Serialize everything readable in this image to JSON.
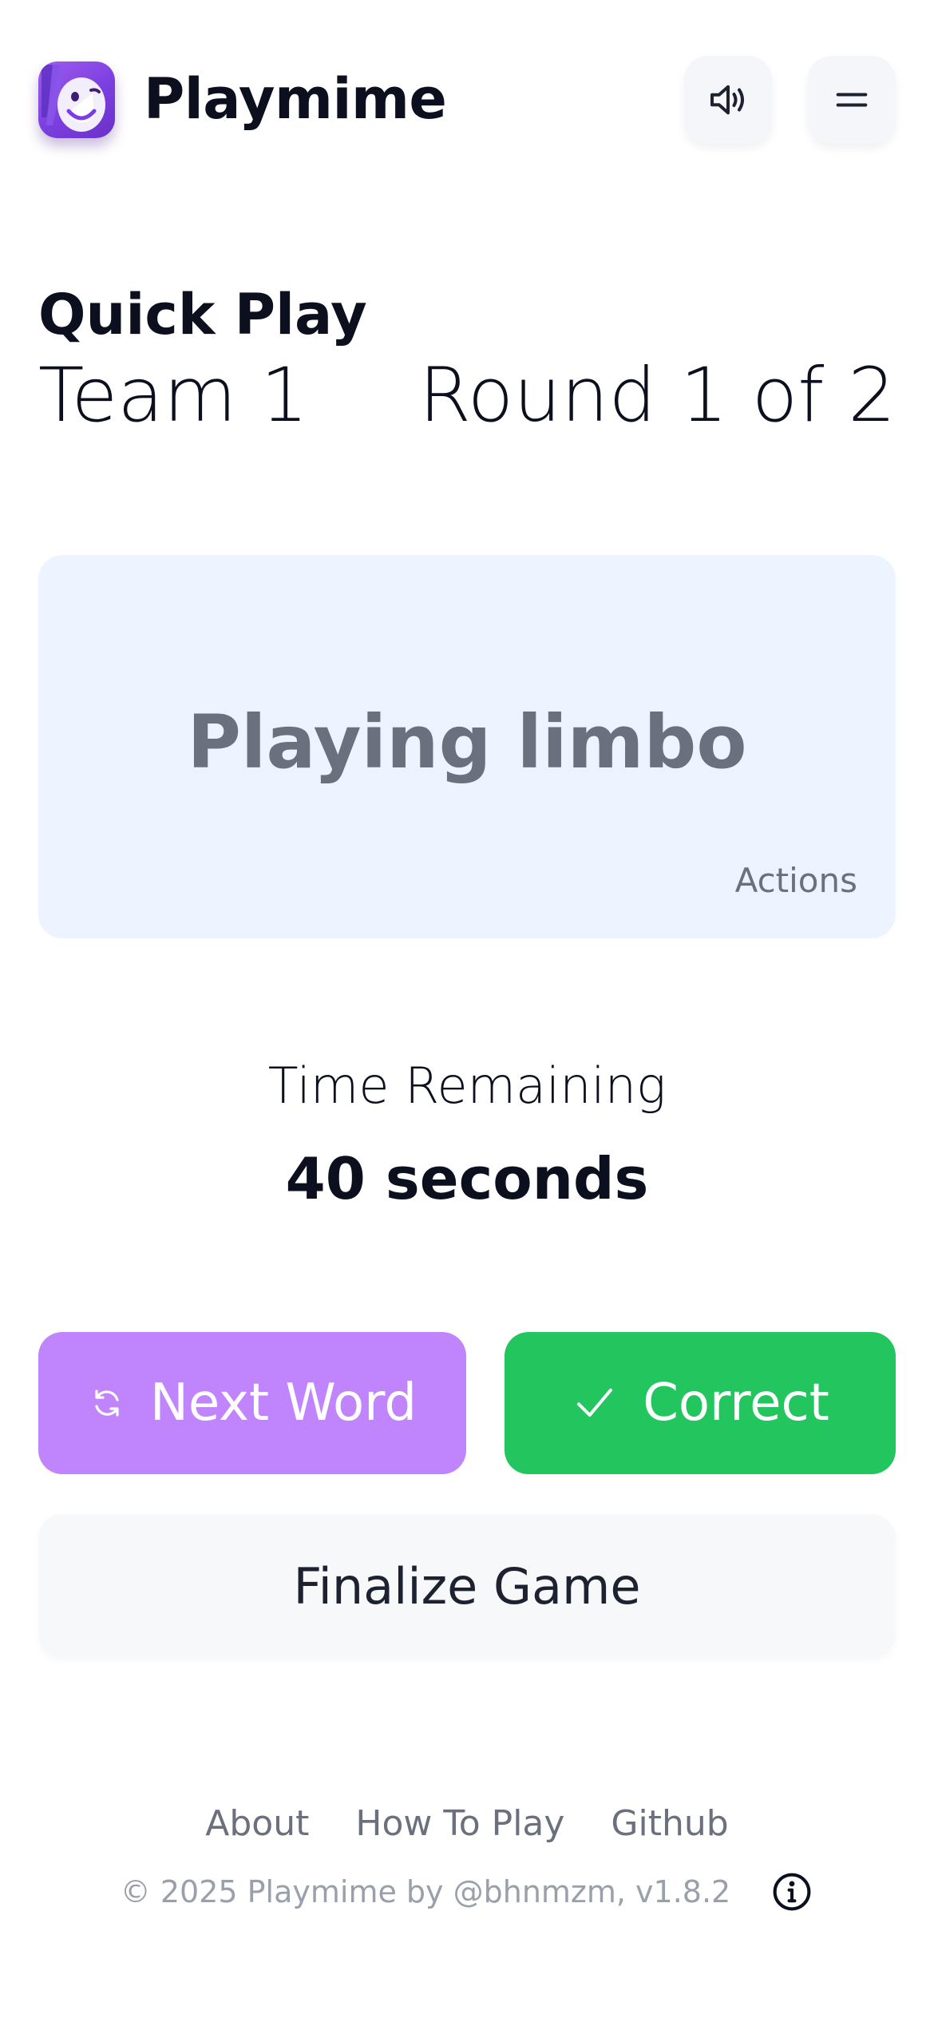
{
  "header": {
    "app_name": "Playmime",
    "logo_icon": "smiling-mime-face",
    "sound_icon": "speaker-icon",
    "menu_icon": "hamburger-menu-icon"
  },
  "game": {
    "mode": "Quick Play",
    "team": "Team 1",
    "round": "Round 1 of 2"
  },
  "card": {
    "word": "Playing limbo",
    "category": "Actions"
  },
  "timer": {
    "label": "Time Remaining",
    "value": "40 seconds"
  },
  "actions": {
    "next_word": "Next Word",
    "correct": "Correct",
    "finalize": "Finalize Game"
  },
  "footer": {
    "links": [
      "About",
      "How To Play",
      "Github"
    ],
    "copyright": "© 2025 Playmime by @bhnmzm, v1.8.2"
  },
  "colors": {
    "next_word_bg": "#c084fc",
    "correct_bg": "#22c55e",
    "card_bg": "#eef4ff"
  }
}
